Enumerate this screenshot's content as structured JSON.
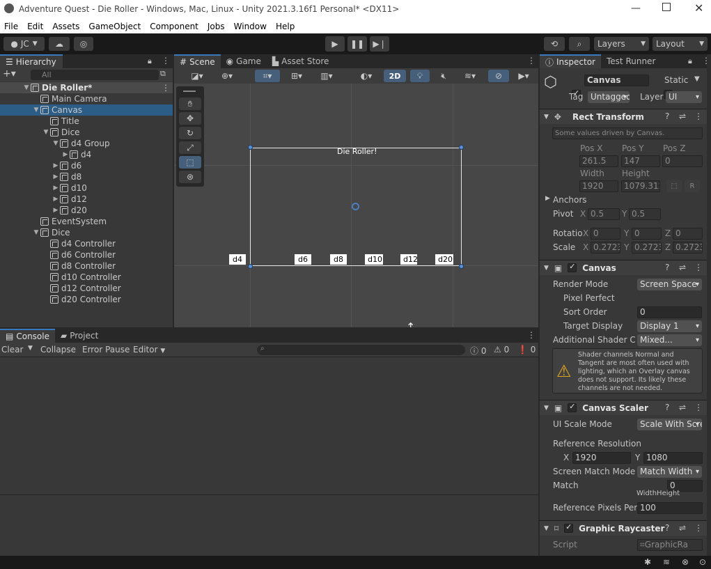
{
  "window": {
    "title": "Adventure Quest - Die Roller - Windows, Mac, Linux - Unity 2021.3.16f1 Personal* <DX11>"
  },
  "menu": [
    "File",
    "Edit",
    "Assets",
    "GameObject",
    "Component",
    "Jobs",
    "Window",
    "Help"
  ],
  "toolbar": {
    "account": "JC",
    "layers": "Layers",
    "layout": "Layout"
  },
  "hierarchy": {
    "tab": "Hierarchy",
    "search_placeholder": "All",
    "items": [
      {
        "label": "Die Roller*"
      },
      {
        "label": "Main Camera"
      },
      {
        "label": "Canvas"
      },
      {
        "label": "Title"
      },
      {
        "label": "Dice"
      },
      {
        "label": "d4 Group"
      },
      {
        "label": "d4"
      },
      {
        "label": "d6"
      },
      {
        "label": "d8"
      },
      {
        "label": "d10"
      },
      {
        "label": "d12"
      },
      {
        "label": "d20"
      },
      {
        "label": "EventSystem"
      },
      {
        "label": "Dice"
      },
      {
        "label": "d4 Controller"
      },
      {
        "label": "d6 Controller"
      },
      {
        "label": "d8 Controller"
      },
      {
        "label": "d10 Controller"
      },
      {
        "label": "d12 Controller"
      },
      {
        "label": "d20 Controller"
      }
    ]
  },
  "scene": {
    "tabs": [
      "Scene",
      "Game",
      "Asset Store"
    ],
    "mode2d": "2D",
    "canvas_title": "Die Roller!",
    "dice_labels": [
      "d4",
      "d6",
      "d8",
      "d10",
      "d12",
      "d20"
    ]
  },
  "console": {
    "tabs": [
      "Console",
      "Project"
    ],
    "clear": "Clear",
    "collapse": "Collapse",
    "error_pause": "Error Pause",
    "editor": "Editor",
    "counts": [
      "0",
      "0",
      "0"
    ]
  },
  "inspector": {
    "tabs": [
      "Inspector",
      "Test Runner"
    ],
    "object_name": "Canvas",
    "static_label": "Static",
    "tag_label": "Tag",
    "tag_value": "Untagged",
    "layer_label": "Layer",
    "layer_value": "UI",
    "rect_transform": {
      "title": "Rect Transform",
      "note": "Some values driven by Canvas.",
      "pos_labels": [
        "Pos X",
        "Pos Y",
        "Pos Z"
      ],
      "pos_values": [
        "261.5",
        "147",
        "0"
      ],
      "size_labels": [
        "Width",
        "Height"
      ],
      "size_values": [
        "1920",
        "1079.312"
      ],
      "r_button": "R",
      "anchors": "Anchors",
      "pivot_label": "Pivot",
      "pivot_x": "0.5",
      "pivot_y": "0.5",
      "rotation_label": "Rotatio",
      "rotation": [
        "0",
        "0",
        "0"
      ],
      "scale_label": "Scale",
      "scale": [
        "0.2723",
        "0.2723",
        "0.2723"
      ],
      "axis_x": "X",
      "axis_y": "Y",
      "axis_z": "Z"
    },
    "canvas": {
      "title": "Canvas",
      "render_mode_label": "Render Mode",
      "render_mode": "Screen Space",
      "pixel_perfect": "Pixel Perfect",
      "sort_order_label": "Sort Order",
      "sort_order": "0",
      "target_display_label": "Target Display",
      "target_display": "Display 1",
      "shader_label": "Additional Shader Ch",
      "shader_value": "Mixed...",
      "warning": "Shader channels Normal and Tangent are most often used with lighting, which an Overlay canvas does not support. Its likely these channels are not needed."
    },
    "scaler": {
      "title": "Canvas Scaler",
      "ui_scale_label": "UI Scale Mode",
      "ui_scale": "Scale With Screen Size",
      "ref_res_label": "Reference Resolution",
      "ref_x": "1920",
      "ref_y": "1080",
      "match_mode_label": "Screen Match Mode",
      "match_mode": "Match Width",
      "match_label": "Match",
      "match_value": "0",
      "width_height": "WidthHeight",
      "ref_pixels_label": "Reference Pixels Per",
      "ref_pixels": "100"
    },
    "raycaster": {
      "title": "Graphic Raycaster",
      "script_label": "Script",
      "script_value": "GraphicRa"
    }
  }
}
